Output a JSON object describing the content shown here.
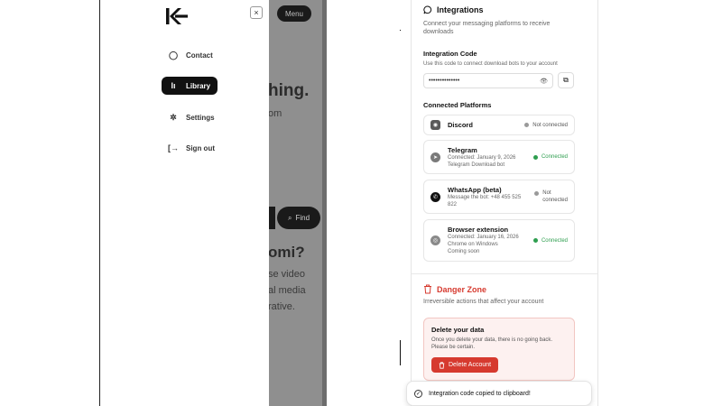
{
  "left_screen": {
    "background": {
      "menu_label": "Menu",
      "headline_fragment": "hing.",
      "subline_fragment": "om",
      "find_label": "Find",
      "question_fragment": "omi?",
      "body_lines": [
        "se video",
        "al media",
        "rative."
      ]
    },
    "drawer": {
      "close_glyph": "×",
      "items": [
        {
          "label": "Contact",
          "icon": "chat-bubble-icon",
          "glyph": "◯",
          "active": false
        },
        {
          "label": "Library",
          "icon": "bars-icon",
          "glyph": "lı",
          "active": true
        },
        {
          "label": "Settings",
          "icon": "gear-icon",
          "glyph": "✲",
          "active": false
        },
        {
          "label": "Sign out",
          "icon": "sign-out-icon",
          "glyph": "[→",
          "active": false
        }
      ]
    }
  },
  "right_screen": {
    "integrations": {
      "title": "Integrations",
      "description_line1": "Connect your messaging platforms to receive",
      "description_line2": "downloads",
      "code_label": "Integration Code",
      "code_hint": "Use this code to connect download bots to your account",
      "code_value": "••••••••••••••",
      "eye_glyph": "👁",
      "copy_glyph": "⧉"
    },
    "connected": {
      "title": "Connected Platforms",
      "platforms": [
        {
          "name": "Discord",
          "icon": "discord-icon",
          "color": "#5a5a5a",
          "lines": [],
          "status": "Not connected",
          "connected": false
        },
        {
          "name": "Telegram",
          "icon": "telegram-icon",
          "color": "#7a7a7a",
          "lines": [
            "Connected: January 9, 2026",
            "Telegram Download bot"
          ],
          "status": "Connected",
          "connected": true
        },
        {
          "name": "WhatsApp (beta)",
          "icon": "whatsapp-icon",
          "color": "#111111",
          "lines": [
            "Message the bot: +48 455 525",
            "822"
          ],
          "status_line1": "Not",
          "status_line2": "connected",
          "connected": false
        },
        {
          "name": "Browser extension",
          "icon": "chrome-icon",
          "color": "#8a8a8a",
          "lines": [
            "Connected: January 16, 2026",
            "Chrome on Windows",
            "Coming soon"
          ],
          "status": "Connected",
          "connected": true
        }
      ]
    },
    "danger": {
      "title": "Danger Zone",
      "subtitle": "Irreversible actions that affect your account",
      "box_title": "Delete your data",
      "box_desc_line1": "Once you delete your data, there is no going back.",
      "box_desc_line2": "Please be certain.",
      "button_label": "Delete Account",
      "accent": "#d63a2f"
    },
    "toast": {
      "message": "Integration code copied to clipboard!"
    }
  }
}
